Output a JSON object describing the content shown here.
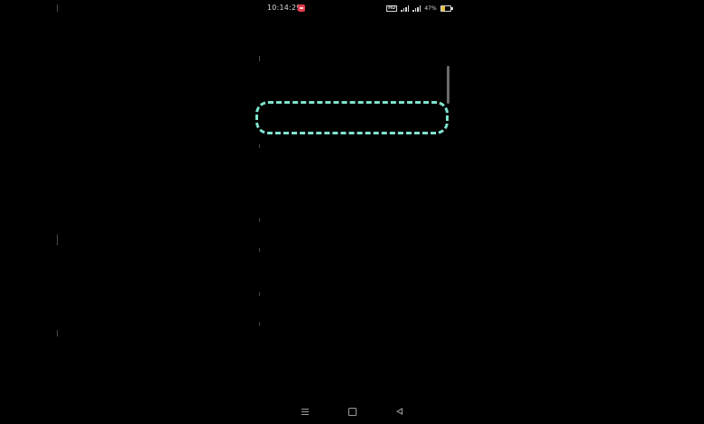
{
  "status_bar": {
    "time": "10:14:29",
    "network_badge": "HD",
    "battery_text": "47%",
    "battery_level": 0.47,
    "notification_icon": "notification-app-icon",
    "signal_icon": "signal-icon",
    "battery_icon": "battery-icon"
  },
  "colors": {
    "background": "#000000",
    "highlight": "#7fe3cf",
    "notification": "#e23a4c",
    "battery_fill": "#e8c33a"
  },
  "nav_bar": {
    "menu_icon": "menu-icon",
    "home_icon": "home-icon",
    "back_icon": "back-icon"
  }
}
